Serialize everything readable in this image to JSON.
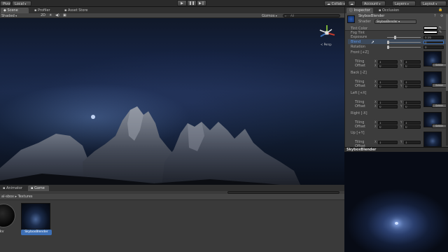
{
  "toolbar": {
    "pivot_label": "Pivot",
    "local_label": "Local",
    "play_icon": "play-icon",
    "pause_icon": "pause-icon",
    "step_icon": "step-icon",
    "collab_label": "Collab",
    "account_label": "Account",
    "layers_label": "Layers",
    "layout_label": "Layout"
  },
  "scene_tabs": [
    "Scene",
    "Profiler",
    "Asset Store"
  ],
  "scene_bar": {
    "shaded_label": "Shaded",
    "mode_2d_label": "2D",
    "gizmos_label": "Gizmos",
    "search_placeholder": "All"
  },
  "gizmo": {
    "persp_label": "< Persp"
  },
  "bottom_tabs": [
    "Animator",
    "Game"
  ],
  "project": {
    "breadcrumb": "al-sbox ▸ Textures",
    "items": [
      {
        "label": "fkv"
      },
      {
        "label": "SkyboxBlender"
      }
    ]
  },
  "inspector": {
    "tabs": [
      "Inspector",
      "Occlusion"
    ],
    "object_name": "SkyboxBlender",
    "shader_label": "Shader",
    "shader_value": "SkyboxBlender",
    "props": [
      {
        "label": "Tint Color"
      },
      {
        "label": "Fog Tint"
      },
      {
        "label": "Exposure",
        "value": "0.56",
        "slider": 0.22
      },
      {
        "label": "Blend",
        "value": "0",
        "slider": 0.0,
        "highlight": true
      },
      {
        "label": "Rotation",
        "value": "0",
        "slider": 0.0
      }
    ],
    "faces": [
      {
        "label": "Front [+Z]"
      },
      {
        "label": "Back [-Z]"
      },
      {
        "label": "Left [+X]"
      },
      {
        "label": "Right [-X]"
      },
      {
        "label": "Up [+Y]"
      }
    ],
    "tiling_label": "Tiling",
    "offset_label": "Offset",
    "x_label": "X",
    "y_label": "Y",
    "tiling_values": [
      "1",
      "1"
    ],
    "offset_values": [
      "0",
      "0"
    ],
    "select_label": "Select"
  },
  "preview": {
    "title": "SkyboxBlender"
  },
  "colors": {
    "accent": "#3d6fb5",
    "panel": "#3c3c3c",
    "sky_glow": "#7aa2e6"
  }
}
